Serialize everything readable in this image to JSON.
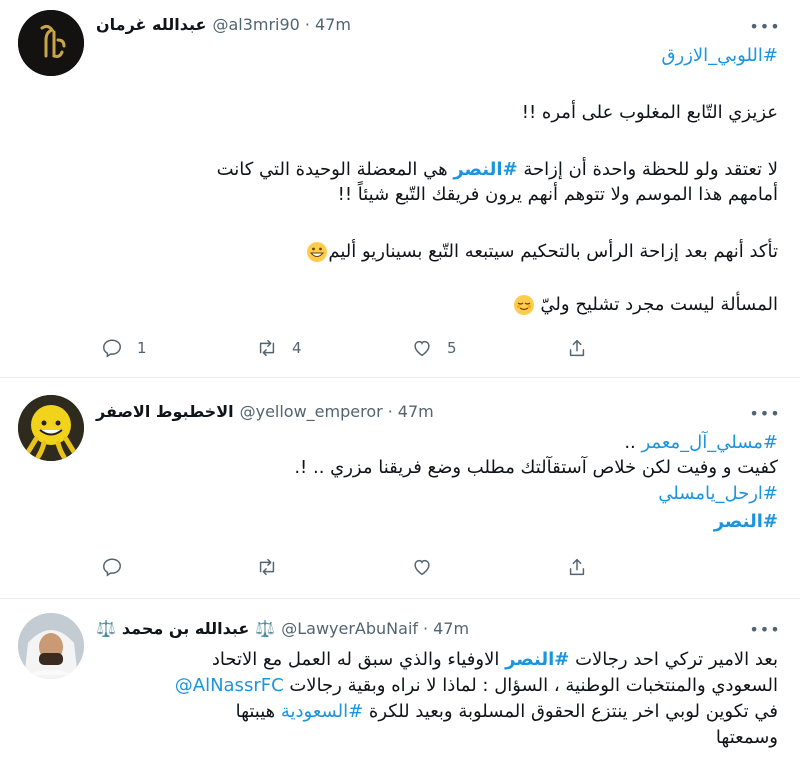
{
  "tweets": [
    {
      "name": "عبدالله غرمان",
      "handle": "@al3mri90",
      "time": "47m",
      "more": "•••",
      "lines": {
        "l1_tag": "#اللوبي_الازرق",
        "l2": "عزيزي التّابع المغلوب على أمره !!",
        "l3_a": "لا تعتقد ولو للحظة واحدة أن إزاحة ",
        "l3_tag": "#النصر",
        "l3_b": " هي المعضلة الوحيدة التي كانت",
        "l4": "أمامهم هذا الموسم ولا تتوهم أنهم يرون فريقك التّبع شيئاً !!",
        "l5": "تأكد أنهم بعد إزاحة الرأس بالتحكيم سيتبعه التّبع بسيناريو أليم",
        "l6": "المسألة ليست مجرد تشليح وليّ"
      },
      "actions": {
        "reply": "1",
        "retweet": "4",
        "like": "5"
      },
      "emoji": [
        "grinning-emoji",
        "relieved-emoji"
      ]
    },
    {
      "name": "الاخطبوط الاصفر",
      "handle": "@yellow_emperor",
      "time": "47m",
      "more": "•••",
      "lines": {
        "l1_tag": "#مسلي_آل_معمر",
        "l1_b": " ..",
        "l2": "كفيت و وفيت لكن خلاص آستقآلتك مطلب وضع فريقنا مزري .. !.",
        "l3_tag": "#ارحل_يامسلي",
        "l4_tag": "#النصر"
      },
      "actions": {
        "reply": "",
        "retweet": "",
        "like": ""
      }
    },
    {
      "name": "عبدالله بن محمد",
      "scale_icon": "⚖️",
      "handle": "@LawyerAbuNaif",
      "time": "47m",
      "more": "•••",
      "lines": {
        "l1_a": "بعد الامير تركي احد رجالات ",
        "l1_tag": "#النصر",
        "l1_b": " الاوفياء والذي سبق له العمل مع الاتحاد",
        "l2": "السعودي والمنتخبات الوطنية ، السؤال : لماذا لا نراه وبقية رجالات ",
        "l2_tag": "@AlNassrFC",
        "l3_a": "في تكوين لوبي اخر ينتزع الحقوق المسلوبة وبعيد للكرة ",
        "l3_tag": "#السعودية",
        "l3_b": " هيبتها",
        "l4": "وسمعتها"
      }
    }
  ]
}
